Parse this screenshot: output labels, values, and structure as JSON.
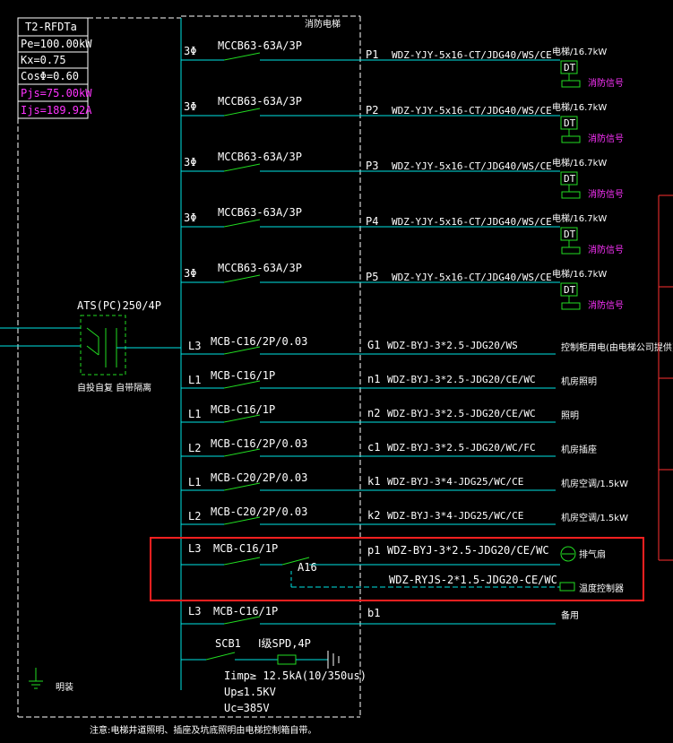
{
  "panel": {
    "name": "T2-RFDTa",
    "pe": "Pe=100.00kW",
    "kx": "Kx=0.75",
    "cos": "CosΦ=0.60",
    "pjs": "Pjs=75.00kW",
    "ijs": "Ijs=189.92A",
    "top_label": "消防电梯"
  },
  "ats": {
    "label": "ATS(PC)250/4P",
    "sub_label": "自投自复 自带隔离"
  },
  "circuits": [
    {
      "phase": "3Φ",
      "breaker": "MCCB63-63A/3P",
      "id": "P1",
      "cable": "WDZ-YJY-5x16-CT/JDG40/WS/CE",
      "load": "电梯/16.7kW",
      "dt": "DT",
      "fire": "消防信号"
    },
    {
      "phase": "3Φ",
      "breaker": "MCCB63-63A/3P",
      "id": "P2",
      "cable": "WDZ-YJY-5x16-CT/JDG40/WS/CE",
      "load": "电梯/16.7kW",
      "dt": "DT",
      "fire": "消防信号"
    },
    {
      "phase": "3Φ",
      "breaker": "MCCB63-63A/3P",
      "id": "P3",
      "cable": "WDZ-YJY-5x16-CT/JDG40/WS/CE",
      "load": "电梯/16.7kW",
      "dt": "DT",
      "fire": "消防信号"
    },
    {
      "phase": "3Φ",
      "breaker": "MCCB63-63A/3P",
      "id": "P4",
      "cable": "WDZ-YJY-5x16-CT/JDG40/WS/CE",
      "load": "电梯/16.7kW",
      "dt": "DT",
      "fire": "消防信号"
    },
    {
      "phase": "3Φ",
      "breaker": "MCCB63-63A/3P",
      "id": "P5",
      "cable": "WDZ-YJY-5x16-CT/JDG40/WS/CE",
      "load": "电梯/16.7kW",
      "dt": "DT",
      "fire": "消防信号"
    }
  ],
  "small_circuits": [
    {
      "phase": "L3",
      "breaker": "MCB-C16/2P/0.03",
      "id": "G1",
      "cable": "WDZ-BYJ-3*2.5-JDG20/WS",
      "load": "控制柜用电(由电梯公司提供)"
    },
    {
      "phase": "L1",
      "breaker": "MCB-C16/1P",
      "id": "n1",
      "cable": "WDZ-BYJ-3*2.5-JDG20/CE/WC",
      "load": "机房照明"
    },
    {
      "phase": "L1",
      "breaker": "MCB-C16/1P",
      "id": "n2",
      "cable": "WDZ-BYJ-3*2.5-JDG20/CE/WC",
      "load": "照明"
    },
    {
      "phase": "L2",
      "breaker": "MCB-C16/2P/0.03",
      "id": "c1",
      "cable": "WDZ-BYJ-3*2.5-JDG20/WC/FC",
      "load": "机房插座"
    },
    {
      "phase": "L1",
      "breaker": "MCB-C20/2P/0.03",
      "id": "k1",
      "cable": "WDZ-BYJ-3*4-JDG25/WC/CE",
      "load": "机房空调/1.5kW"
    },
    {
      "phase": "L2",
      "breaker": "MCB-C20/2P/0.03",
      "id": "k2",
      "cable": "WDZ-BYJ-3*4-JDG25/WC/CE",
      "load": "机房空调/1.5kW"
    }
  ],
  "fan_circuit": {
    "phase": "L3",
    "breaker": "MCB-C16/1P",
    "id": "p1",
    "cable": "WDZ-BYJ-3*2.5-JDG20/CE/WC",
    "load": "排气扇",
    "relay": "A16",
    "ctrl_cable": "WDZ-RYJS-2*1.5-JDG20-CE/WC",
    "ctrl_load": "温度控制器"
  },
  "spare_circuit": {
    "phase": "L3",
    "breaker": "MCB-C16/1P",
    "id": "b1",
    "load": "备用"
  },
  "spd": {
    "scb": "SCB1",
    "label": "Ⅰ级SPD,4P",
    "imp": "Iimp≥ 12.5kA(10/350us)",
    "up": "Up≤1.5KV",
    "uc": "Uc=385V"
  },
  "ground_label": "明装",
  "note": "注意:电梯井道照明、插座及坑底照明由电梯控制箱自带。",
  "colors": {
    "bus": "#00e5e5",
    "breaker": "#22dd22",
    "highlight": "#ff2020",
    "magenta": "#ff33ff",
    "red_mark": "#ff3030"
  }
}
